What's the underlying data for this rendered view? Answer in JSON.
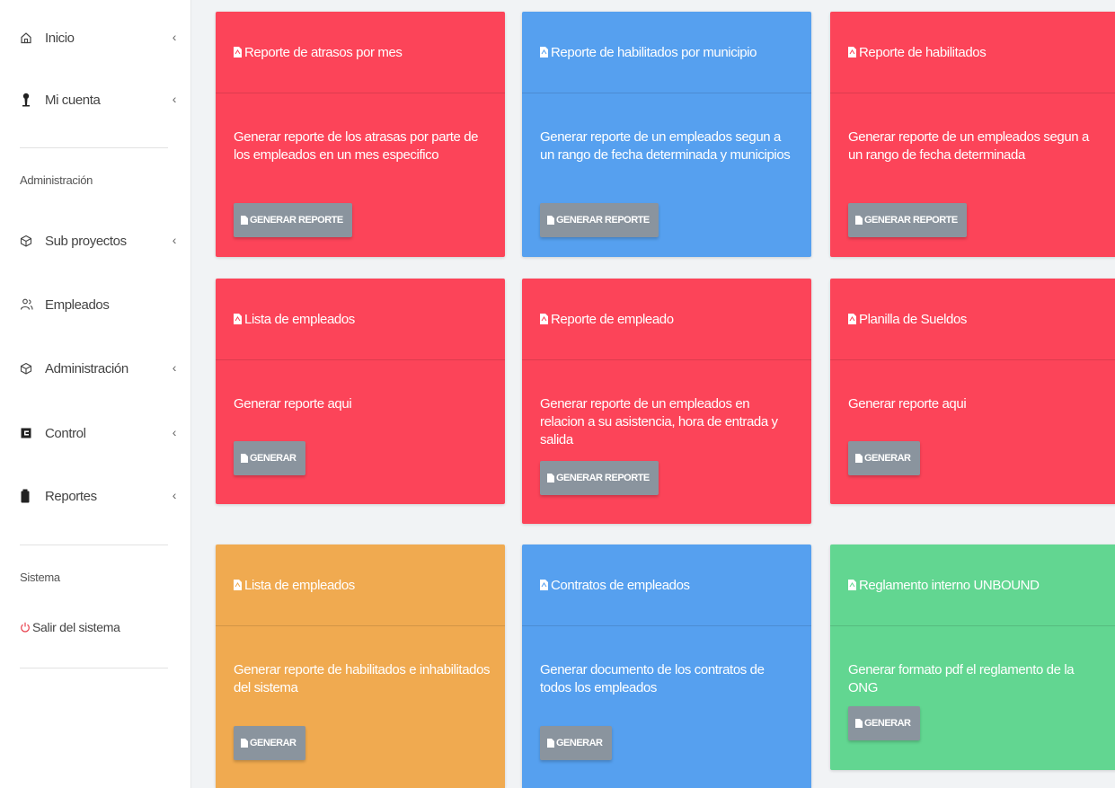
{
  "sidebar": {
    "items": [
      {
        "label": "Inicio",
        "icon": "home-icon"
      },
      {
        "label": "Mi cuenta",
        "icon": "user-icon"
      },
      {
        "label": "Sub proyectos",
        "icon": "cube-icon"
      },
      {
        "label": "Empleados",
        "icon": "users-icon"
      },
      {
        "label": "Administración",
        "icon": "cube-icon"
      },
      {
        "label": "Control",
        "icon": "control-icon"
      },
      {
        "label": "Reportes",
        "icon": "clipboard-icon"
      }
    ],
    "section_admin": "Administración",
    "section_system": "Sistema",
    "logout": "Salir del sistema"
  },
  "colors": {
    "red": "#fc4459",
    "blue": "#56a0ef",
    "orange": "#f0aa50",
    "green": "#62d691",
    "button": "#8a949e"
  },
  "cards": [
    {
      "title": "Reporte de atrasos por mes",
      "description": "Generar reporte de los atrasas por parte de los empleados en un mes especifico",
      "button": "GENERAR REPORTE"
    },
    {
      "title": "Reporte de habilitados por municipio",
      "description": "Generar reporte de un empleados segun a un rango de fecha determinada y municipios",
      "button": "GENERAR REPORTE"
    },
    {
      "title": "Reporte de habilitados",
      "description": "Generar reporte de un empleados segun a un rango de fecha determinada",
      "button": "GENERAR REPORTE"
    },
    {
      "title": "Lista de empleados",
      "description": "Generar reporte aqui",
      "button": "GENERAR"
    },
    {
      "title": "Reporte de empleado",
      "description": "Generar reporte de un empleados en relacion a su asistencia, hora de entrada y salida",
      "button": "GENERAR REPORTE"
    },
    {
      "title": "Planilla de Sueldos",
      "description": "Generar reporte aqui",
      "button": "GENERAR"
    },
    {
      "title": "Lista de empleados",
      "description": "Generar reporte de habilitados e inhabilitados del sistema",
      "button": "GENERAR"
    },
    {
      "title": "Contratos de empleados",
      "description": "Generar documento de los contratos de todos los empleados",
      "button": "GENERAR"
    },
    {
      "title": "Reglamento interno UNBOUND",
      "description": "Generar formato pdf el reglamento de la ONG",
      "button": "GENERAR"
    }
  ]
}
